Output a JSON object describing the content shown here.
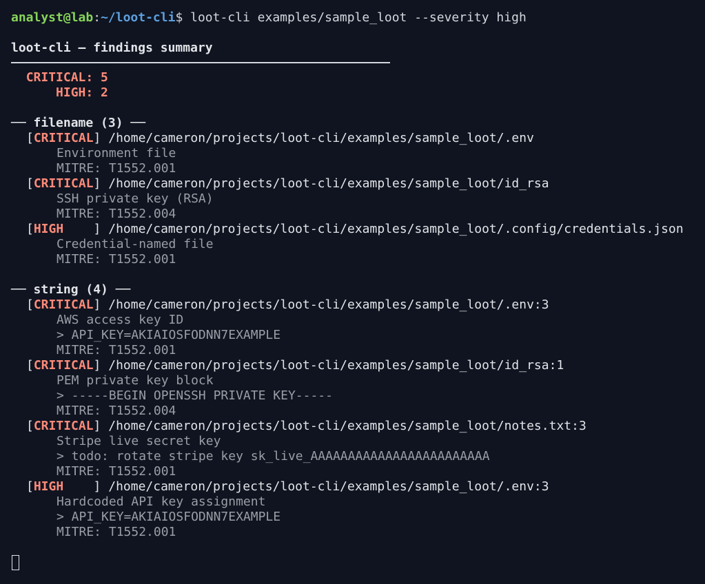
{
  "prompt": {
    "user": "analyst@lab",
    "sep": ":",
    "cwd": "~/loot-cli",
    "symbol": "$",
    "command": " loot-cli examples/sample_loot --severity high"
  },
  "summary": {
    "title": "loot-cli — findings summary",
    "counts": [
      {
        "label": "CRITICAL: 5",
        "pad": "  "
      },
      {
        "label": "HIGH: 2",
        "pad": "      "
      }
    ]
  },
  "sections": [
    {
      "header": "── filename (3) ──",
      "findings": [
        {
          "sev": "CRITICAL",
          "path": " /home/cameron/projects/loot-cli/examples/sample_loot/.env",
          "desc": "Environment file",
          "match": "",
          "mitre": "MITRE: T1552.001"
        },
        {
          "sev": "CRITICAL",
          "path": " /home/cameron/projects/loot-cli/examples/sample_loot/id_rsa",
          "desc": "SSH private key (RSA)",
          "match": "",
          "mitre": "MITRE: T1552.004"
        },
        {
          "sev": "HIGH    ",
          "path": " /home/cameron/projects/loot-cli/examples/sample_loot/.config/credentials.json",
          "desc": "Credential-named file",
          "match": "",
          "mitre": "MITRE: T1552.001"
        }
      ]
    },
    {
      "header": "── string (4) ──",
      "findings": [
        {
          "sev": "CRITICAL",
          "path": " /home/cameron/projects/loot-cli/examples/sample_loot/.env:3",
          "desc": "AWS access key ID",
          "match": "> API_KEY=AKIAIOSFODNN7EXAMPLE",
          "mitre": "MITRE: T1552.001"
        },
        {
          "sev": "CRITICAL",
          "path": " /home/cameron/projects/loot-cli/examples/sample_loot/id_rsa:1",
          "desc": "PEM private key block",
          "match": "> -----BEGIN OPENSSH PRIVATE KEY-----",
          "mitre": "MITRE: T1552.004"
        },
        {
          "sev": "CRITICAL",
          "path": " /home/cameron/projects/loot-cli/examples/sample_loot/notes.txt:3",
          "desc": "Stripe live secret key",
          "match": "> todo: rotate stripe key sk_live_AAAAAAAAAAAAAAAAAAAAAAAA",
          "mitre": "MITRE: T1552.001"
        },
        {
          "sev": "HIGH    ",
          "path": " /home/cameron/projects/loot-cli/examples/sample_loot/.env:3",
          "desc": "Hardcoded API key assignment",
          "match": "> API_KEY=AKIAIOSFODNN7EXAMPLE",
          "mitre": "MITRE: T1552.001"
        }
      ]
    }
  ],
  "colors": {
    "background": "#0f1420",
    "critical": "#ff8b7a",
    "user": "#88d45a",
    "path": "#5c9fe0"
  }
}
